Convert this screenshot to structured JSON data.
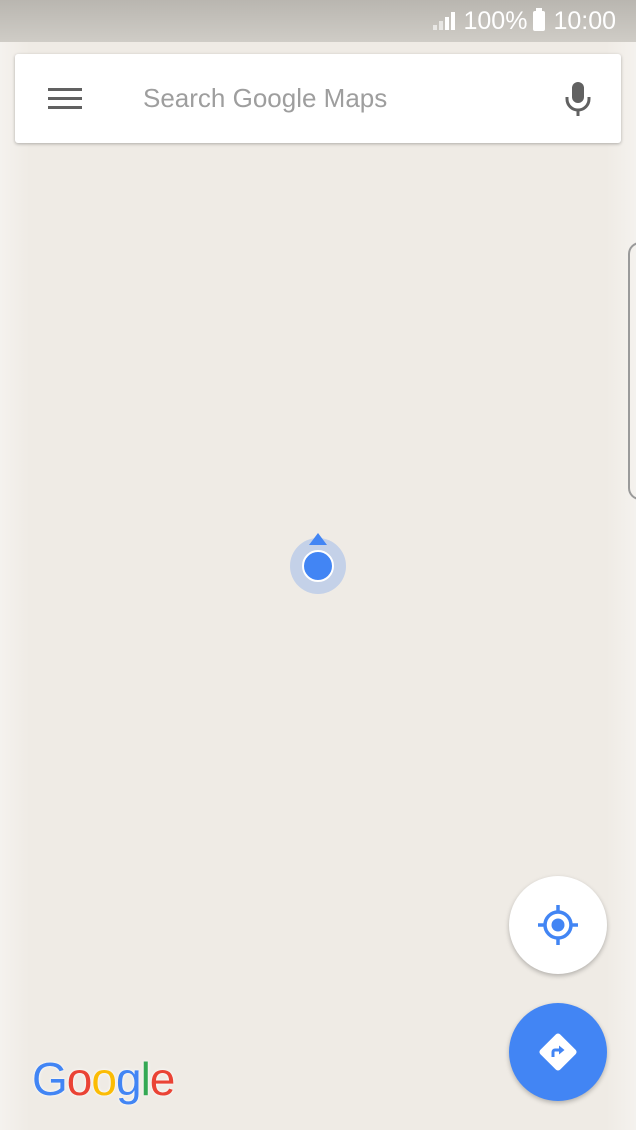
{
  "status_bar": {
    "battery_percent": "100%",
    "time": "10:00",
    "icons": [
      "signal-icon",
      "battery-icon"
    ]
  },
  "search": {
    "placeholder": "Search Google Maps",
    "value": "",
    "menu_icon": "menu-icon",
    "mic_icon": "microphone-icon"
  },
  "map": {
    "background_color": "#efebe5",
    "marker_icon": "my-location-marker-icon"
  },
  "fabs": {
    "my_location_icon": "my-location-icon",
    "directions_icon": "directions-icon"
  },
  "logo": {
    "text": "Google",
    "letters": [
      {
        "char": "G",
        "color": "#4285f4"
      },
      {
        "char": "o",
        "color": "#ea4335"
      },
      {
        "char": "o",
        "color": "#fbbc05"
      },
      {
        "char": "g",
        "color": "#4285f4"
      },
      {
        "char": "l",
        "color": "#34a853"
      },
      {
        "char": "e",
        "color": "#ea4335"
      }
    ]
  },
  "colors": {
    "accent": "#4285f4",
    "icon_gray": "#616161"
  }
}
